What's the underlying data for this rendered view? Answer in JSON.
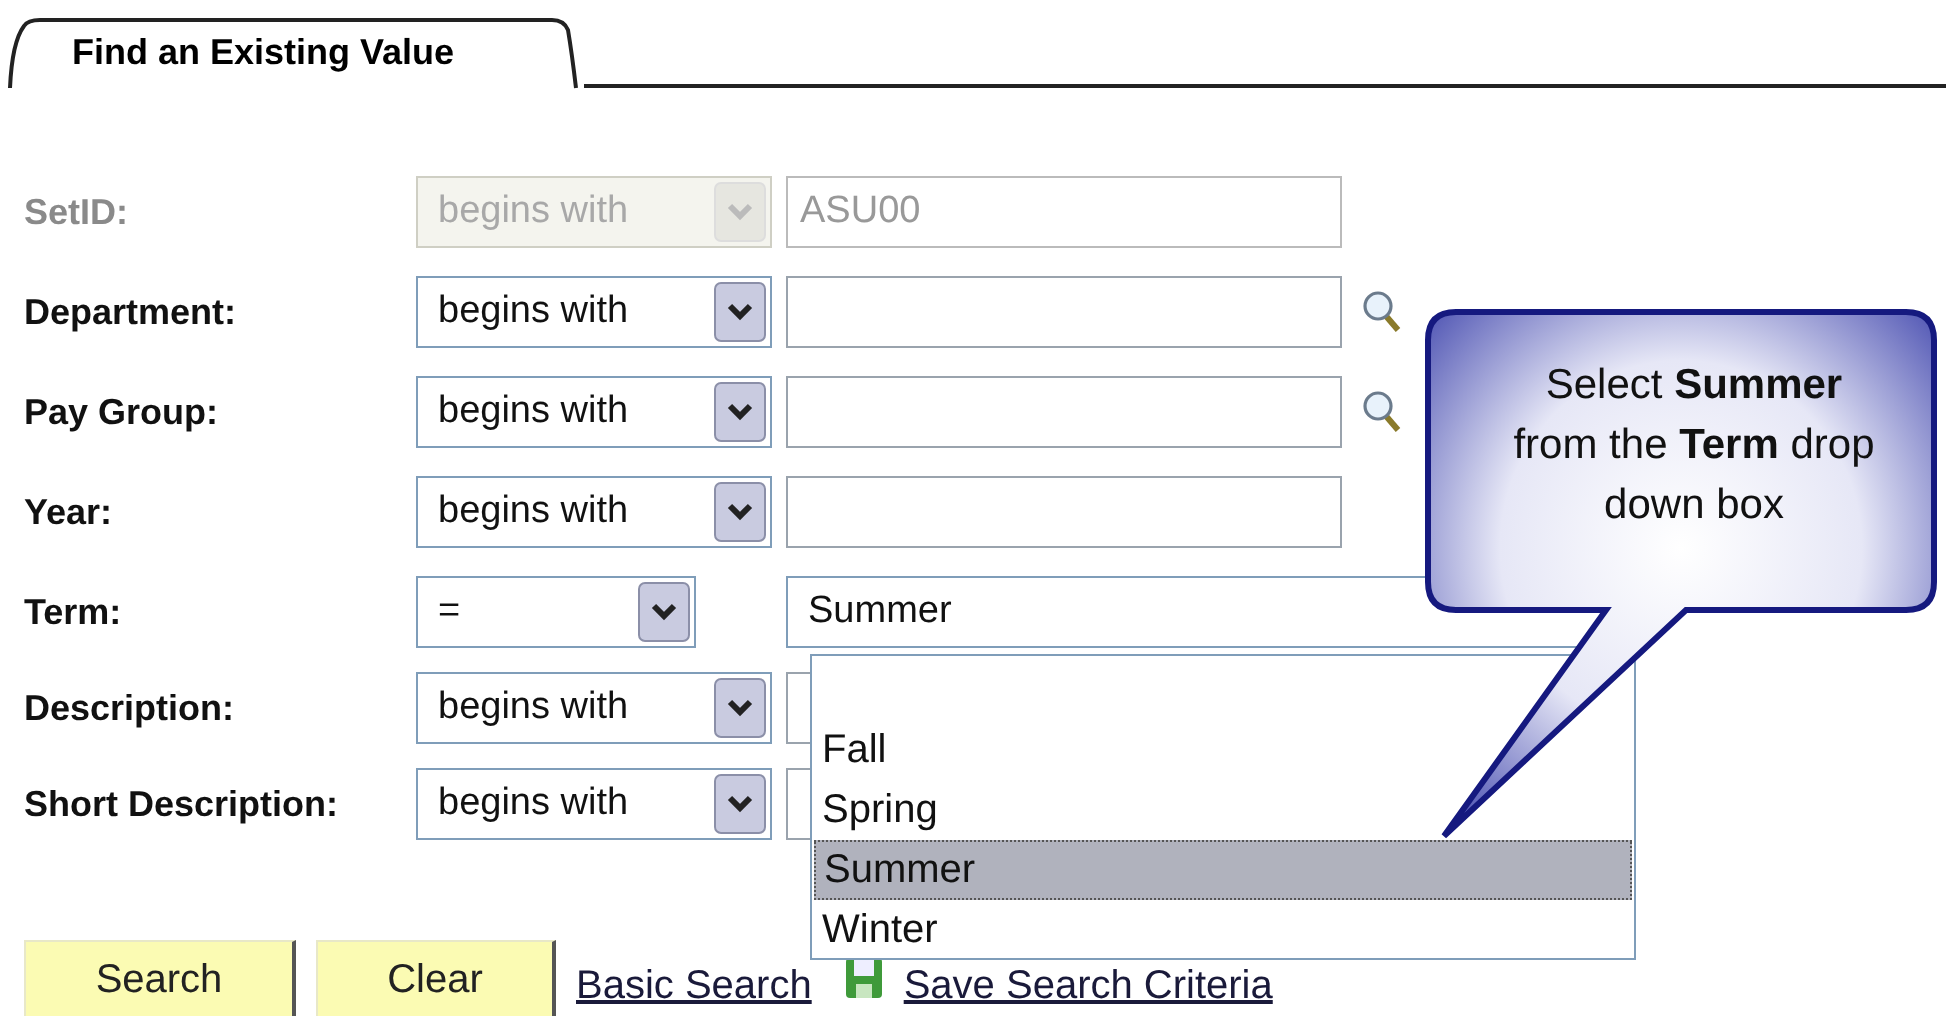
{
  "tab": {
    "label": "Find an Existing Value",
    "selected": true
  },
  "fields": [
    {
      "label": "SetID:",
      "operator": "begins with",
      "value": "ASU00",
      "disabled": true,
      "lookup": false,
      "kind": "text"
    },
    {
      "label": "Department:",
      "operator": "begins with",
      "disabled": false,
      "lookup": true,
      "kind": "text"
    },
    {
      "label": "Pay Group:",
      "operator": "begins with",
      "disabled": false,
      "lookup": true,
      "kind": "text"
    },
    {
      "label": "Year:",
      "operator": "begins with",
      "disabled": false,
      "lookup": false,
      "kind": "text"
    },
    {
      "label": "Term:",
      "operator": "=",
      "value": "Summer",
      "disabled": false,
      "lookup": false,
      "kind": "dropdown",
      "expanded": true,
      "options": [
        {
          "label": "Fall",
          "selected": false
        },
        {
          "label": "Spring",
          "selected": false
        },
        {
          "label": "Summer",
          "selected": true
        },
        {
          "label": "Winter",
          "selected": false
        }
      ]
    },
    {
      "label": "Description:",
      "operator": "begins with",
      "disabled": false,
      "kind": "text"
    },
    {
      "label": "Short Description:",
      "operator": "begins with",
      "disabled": false,
      "kind": "text"
    }
  ],
  "callout": "Select **Summer** from the **Term** drop down box",
  "buttons": [
    "Search",
    "Clear"
  ],
  "links": [
    {
      "label": "Basic Search"
    },
    {
      "label": "Save Search Criteria",
      "icon": true
    }
  ]
}
